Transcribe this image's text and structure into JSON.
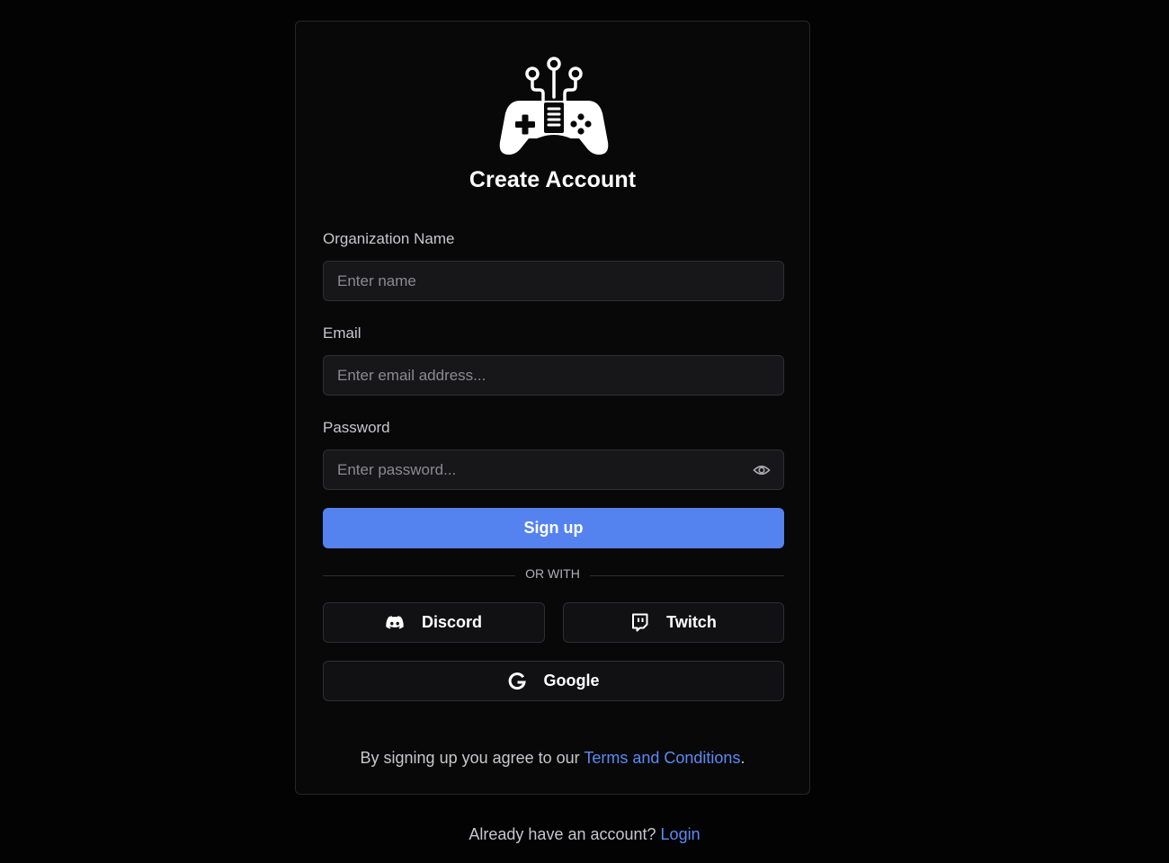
{
  "header": {
    "title": "Create Account",
    "logo_icon": "gamepad-circuit-icon"
  },
  "form": {
    "org_name": {
      "label": "Organization Name",
      "placeholder": "Enter name",
      "value": ""
    },
    "email": {
      "label": "Email",
      "placeholder": "Enter email address...",
      "value": ""
    },
    "password": {
      "label": "Password",
      "placeholder": "Enter password...",
      "value": "",
      "toggle_icon": "eye-icon"
    },
    "submit_label": "Sign up"
  },
  "divider": {
    "label": "OR WITH"
  },
  "social": {
    "discord": {
      "label": "Discord",
      "icon": "discord-icon"
    },
    "twitch": {
      "label": "Twitch",
      "icon": "twitch-icon"
    },
    "google": {
      "label": "Google",
      "icon": "google-icon"
    }
  },
  "terms": {
    "prefix": "By signing up you agree to our ",
    "link": "Terms and Conditions",
    "suffix": "."
  },
  "footer": {
    "prefix": "Already have an account? ",
    "link": "Login"
  },
  "colors": {
    "background": "#030303",
    "card": "#080808",
    "input": "#17171a",
    "primary": "#5483f0",
    "link": "#5b8af5"
  }
}
